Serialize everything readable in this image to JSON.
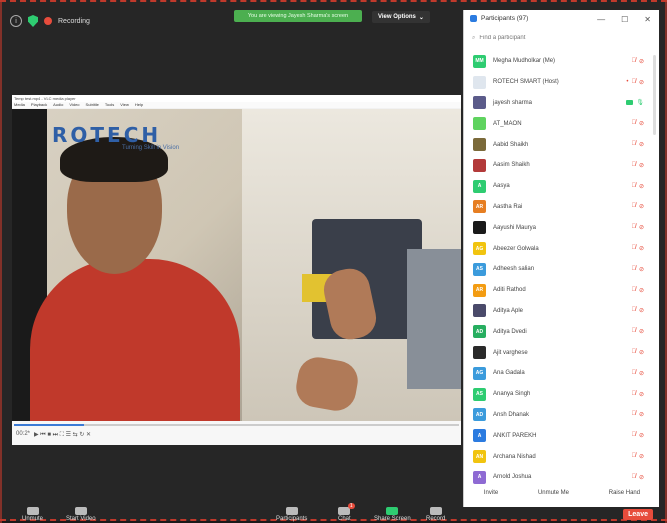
{
  "topbar": {
    "info_icon": "info-icon",
    "shield_icon": "shield-icon",
    "recording_label": "Recording"
  },
  "banner": {
    "text": "You are viewing Jayesh Sharma's screen"
  },
  "view_options": {
    "label": "View Options",
    "chevron": "⌄"
  },
  "vlc": {
    "title": "Temp test.mp4 - VLC media player",
    "menu": [
      "Media",
      "Playback",
      "Audio",
      "Video",
      "Subtitle",
      "Tools",
      "View",
      "Help"
    ],
    "logo_text": "ROTECH",
    "logo_sub": "Turning Skill in Vision",
    "time_left": "00:2*",
    "controls": "▶  ⏮ ■ ⏭  ⛶ ☰  ⇆ ↻  ✕"
  },
  "bottom_bar": {
    "unmute": "Unmute",
    "start_video": "Start Video",
    "participants": "Participants",
    "chat": "Chat",
    "share_screen": "Share Screen",
    "record": "Record",
    "leave": "Leave",
    "chat_badge": "1"
  },
  "panel": {
    "title": "Participants (97)",
    "search_placeholder": "Find a participant",
    "minimize": "—",
    "restore": "☐",
    "close": "✕",
    "participants": [
      {
        "initials": "MM",
        "name": "Megha Mudholkar (Me)",
        "color": "#2ecc71"
      },
      {
        "initials": "",
        "name": "ROTECH SMART (Host)",
        "color": "#dfe6ee"
      },
      {
        "initials": "",
        "name": "jayesh sharma",
        "color": "#5b5b8a"
      },
      {
        "initials": "",
        "name": "AT_MAON",
        "color": "#5fd35f"
      },
      {
        "initials": "",
        "name": "Aabid Shaikh",
        "color": "#7b6a3a"
      },
      {
        "initials": "",
        "name": "Aasim Shaikh",
        "color": "#b33a3a"
      },
      {
        "initials": "A",
        "name": "Aasya",
        "color": "#2ecc71"
      },
      {
        "initials": "AR",
        "name": "Aastha Rai",
        "color": "#e67e22"
      },
      {
        "initials": "",
        "name": "Aayushi Maurya",
        "color": "#1a1a1a"
      },
      {
        "initials": "AG",
        "name": "Abeezer Golwala",
        "color": "#f1c40f"
      },
      {
        "initials": "AS",
        "name": "Adheesh salian",
        "color": "#3b9bdc"
      },
      {
        "initials": "AR",
        "name": "Aditi Rathod",
        "color": "#f39c12"
      },
      {
        "initials": "",
        "name": "Aditya Aple",
        "color": "#4a4a6a"
      },
      {
        "initials": "AD",
        "name": "Aditya Dvedi",
        "color": "#27ae60"
      },
      {
        "initials": "",
        "name": "Ajit varghese",
        "color": "#2a2a2a"
      },
      {
        "initials": "AG",
        "name": "Ana Gadala",
        "color": "#3b9bdc"
      },
      {
        "initials": "AS",
        "name": "Ananya Singh",
        "color": "#2ecc71"
      },
      {
        "initials": "AD",
        "name": "Ansh Dhanak",
        "color": "#3b9bdc"
      },
      {
        "initials": "A",
        "name": "ANKIT PAREKH",
        "color": "#2b7be0"
      },
      {
        "initials": "AN",
        "name": "Archana Nishad",
        "color": "#f1c40f"
      },
      {
        "initials": "A",
        "name": "Arnold Joshua",
        "color": "#8e6ad3"
      }
    ],
    "footer": {
      "invite": "Invite",
      "unmute_me": "Unmute Me",
      "raise_hand": "Raise Hand"
    }
  }
}
